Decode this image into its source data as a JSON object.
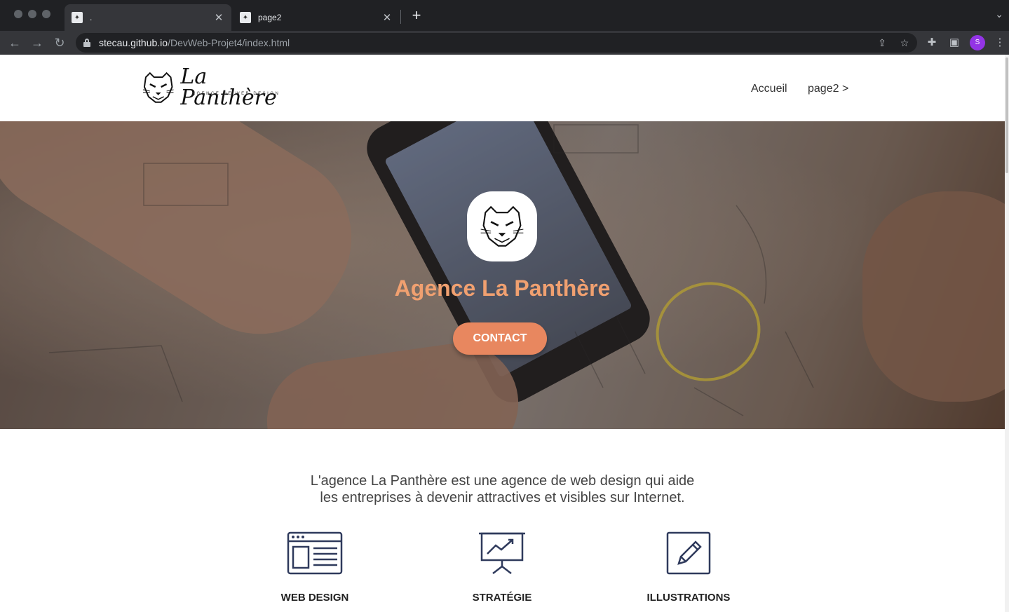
{
  "browser": {
    "tabs": [
      {
        "title": ".",
        "active": true
      },
      {
        "title": "page2",
        "active": false
      }
    ],
    "url_host": "stecau.github.io",
    "url_path": "/DevWeb-Projet4/index.html",
    "profile_initial": "S"
  },
  "site": {
    "logo_text": "La Panthère",
    "logo_subtitle": "AGENCE DE WEB DESIGN",
    "nav": [
      {
        "label": "Accueil"
      },
      {
        "label": "page2 >"
      }
    ]
  },
  "hero": {
    "title": "Agence La Panthère",
    "button_label": "CONTACT"
  },
  "intro": {
    "line1": "L'agence La Panthère est une agence de web design qui aide",
    "line2": "les entreprises à devenir attractives et visibles sur Internet."
  },
  "services": [
    {
      "label": "WEB DESIGN",
      "icon": "browser-window-icon"
    },
    {
      "label": "STRATÉGIE",
      "icon": "presentation-chart-icon"
    },
    {
      "label": "ILLUSTRATIONS",
      "icon": "pencil-icon"
    }
  ],
  "colors": {
    "accent": "#e8875f",
    "hero_title": "#f0a070",
    "icon_stroke": "#2f3a5c"
  }
}
